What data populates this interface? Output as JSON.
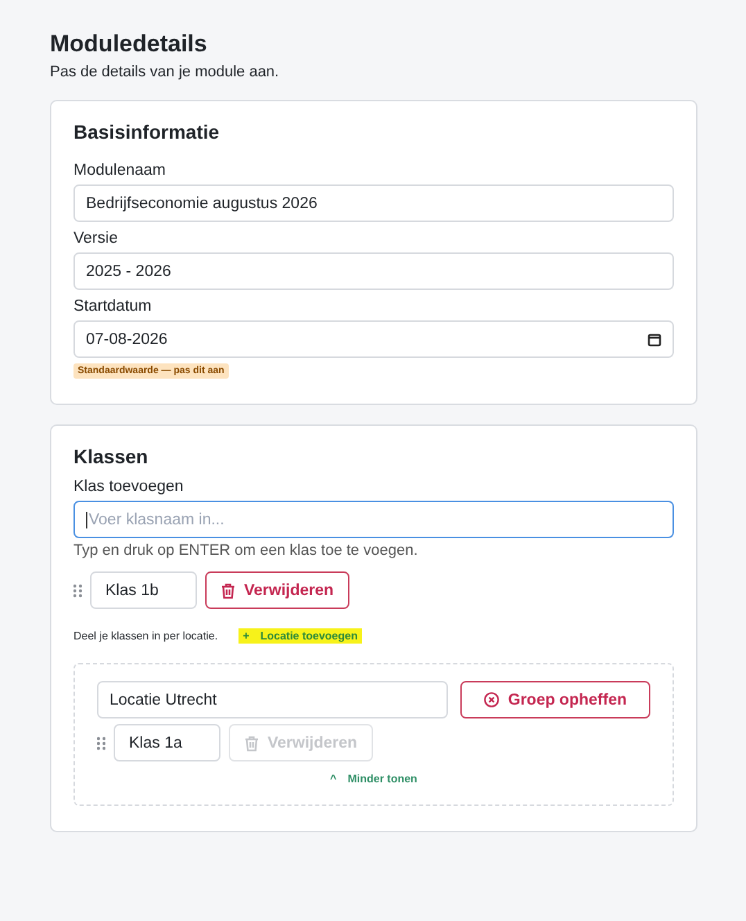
{
  "header": {
    "title": "Moduledetails",
    "subtitle": "Pas de details van je module aan."
  },
  "basis": {
    "title": "Basisinformatie",
    "fields": [
      {
        "label": "Modulenaam",
        "value": "Bedrijfseconomie augustus 2026",
        "kind": "text"
      },
      {
        "label": "Versie",
        "value": "2025 - 2026",
        "kind": "text"
      },
      {
        "label": "Startdatum",
        "value": "07-08-2026",
        "kind": "date"
      }
    ],
    "badge": "Standaardwaarde — pas dit aan"
  },
  "klassen": {
    "title": "Klassen",
    "add_label": "Klas toevoegen",
    "add_placeholder": "Voer klasnaam in...",
    "hint": "Typ en druk op ENTER om een klas toe te voegen.",
    "classes": [
      {
        "name": "Klas 1b",
        "remove": "Verwijderen",
        "disabled": false
      }
    ],
    "location_text": "Deel je klassen in per locatie.",
    "add_location": {
      "icon": "+",
      "label": "Locatie toevoegen",
      "highlighted": true
    },
    "groups": [
      {
        "name": "Locatie Utrecht",
        "ungroup": "Groep opheffen",
        "classes": [
          {
            "name": "Klas 1a",
            "remove": "Verwijderen",
            "disabled": true
          }
        ],
        "toggle": {
          "icon": "^",
          "label": "Minder tonen",
          "expanded": true
        }
      }
    ]
  }
}
